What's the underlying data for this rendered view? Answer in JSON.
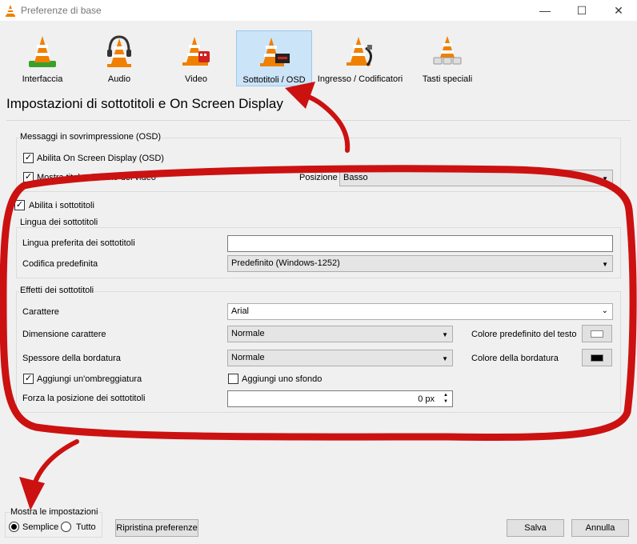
{
  "window": {
    "title": "Preferenze di base"
  },
  "categories": [
    {
      "label": "Interfaccia",
      "icon": "interface-icon",
      "selected": false
    },
    {
      "label": "Audio",
      "icon": "audio-icon",
      "selected": false
    },
    {
      "label": "Video",
      "icon": "video-icon",
      "selected": false
    },
    {
      "label": "Sottotitoli / OSD",
      "icon": "subtitles-icon",
      "selected": true
    },
    {
      "label": "Ingresso / Codificatori",
      "icon": "input-codecs-icon",
      "selected": false
    },
    {
      "label": "Tasti speciali",
      "icon": "hotkeys-icon",
      "selected": false
    }
  ],
  "page": {
    "heading": "Impostazioni di sottotitoli e On Screen Display"
  },
  "osd": {
    "group_label": "Messaggi in sovrimpressione (OSD)",
    "enable_osd_label": "Abilita On Screen Display (OSD)",
    "enable_osd_checked": true,
    "show_title_label": "Mostra titolo all'avvio del video",
    "show_title_checked": true,
    "position_label": "Posizione",
    "position_value": "Basso"
  },
  "subtitles": {
    "enable_label": "Abilita i sottotitoli",
    "enable_checked": true,
    "language": {
      "group_label": "Lingua dei sottotitoli",
      "preferred_label": "Lingua preferita dei sottotitoli",
      "preferred_value": "",
      "encoding_label": "Codifica predefinita",
      "encoding_value": "Predefinito (Windows-1252)"
    },
    "effects": {
      "group_label": "Effetti dei sottotitoli",
      "font_label": "Carattere",
      "font_value": "Arial",
      "size_label": "Dimensione carattere",
      "size_value": "Normale",
      "text_color_label": "Colore predefinito del testo",
      "text_color": "#ffffff",
      "outline_label": "Spessore della bordatura",
      "outline_value": "Normale",
      "outline_color_label": "Colore della bordatura",
      "outline_color": "#000000",
      "shadow_label": "Aggiungi un'ombreggiatura",
      "shadow_checked": true,
      "background_label": "Aggiungi uno sfondo",
      "background_checked": false,
      "force_position_label": "Forza la posizione dei sottotitoli",
      "force_position_value": "0 px"
    }
  },
  "footer": {
    "show_settings_label": "Mostra le impostazioni",
    "simple_label": "Semplice",
    "simple_selected": true,
    "all_label": "Tutto",
    "all_selected": false,
    "reset_label": "Ripristina preferenze",
    "save_label": "Salva",
    "cancel_label": "Annulla"
  },
  "annotation_color": "#cc1111"
}
